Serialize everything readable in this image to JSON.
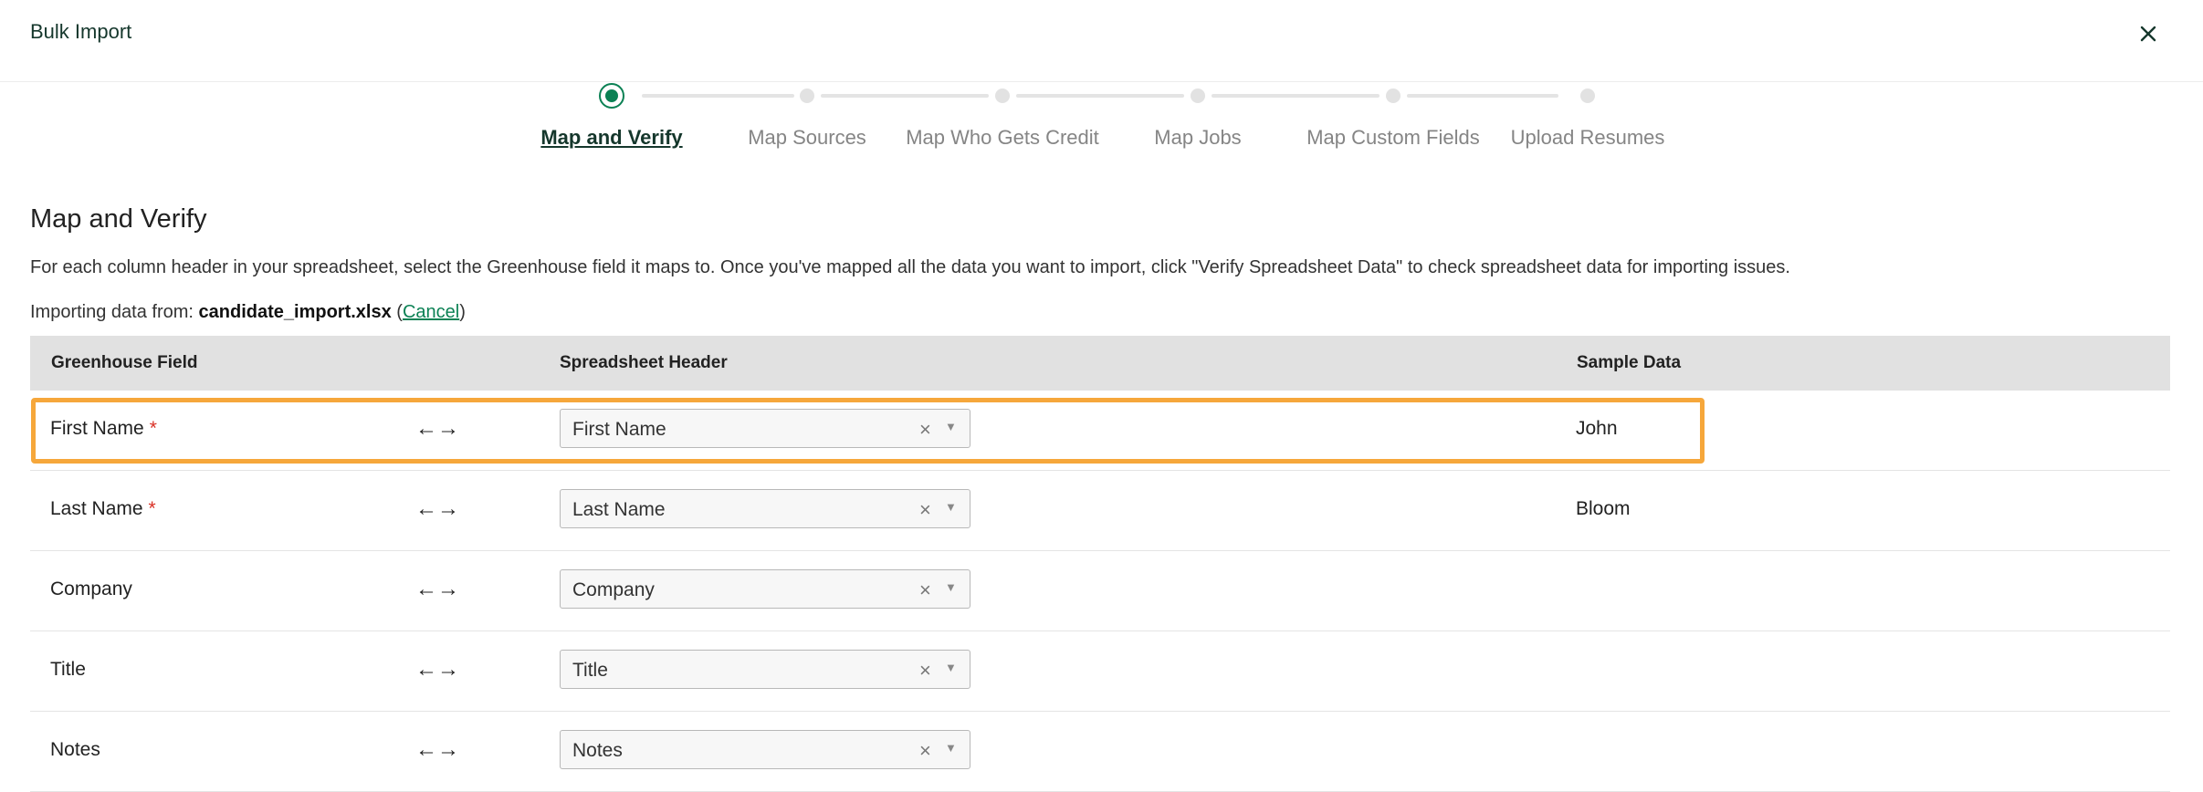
{
  "header": {
    "title": "Bulk Import"
  },
  "steps": [
    {
      "label": "Map and Verify"
    },
    {
      "label": "Map Sources"
    },
    {
      "label": "Map Who Gets Credit"
    },
    {
      "label": "Map Jobs"
    },
    {
      "label": "Map Custom Fields"
    },
    {
      "label": "Upload Resumes"
    }
  ],
  "active_step": 0,
  "section": {
    "title": "Map and Verify",
    "description": "For each column header in your spreadsheet, select the Greenhouse field it maps to. Once you've mapped all the data you want to import, click \"Verify Spreadsheet Data\" to check spreadsheet data for importing issues.",
    "import_prefix": "Importing data from:",
    "filename": "candidate_import.xlsx",
    "cancel_label": "Cancel"
  },
  "table": {
    "headers": {
      "field": "Greenhouse Field",
      "spreadsheet": "Spreadsheet Header",
      "sample": "Sample Data"
    },
    "arrow_glyph": "←→",
    "clear_glyph": "×",
    "dropdown_glyph": "▼",
    "required_mark": "*",
    "rows": [
      {
        "field": "First Name",
        "required": true,
        "header": "First Name",
        "sample": "John"
      },
      {
        "field": "Last Name",
        "required": true,
        "header": "Last Name",
        "sample": "Bloom"
      },
      {
        "field": "Company",
        "required": false,
        "header": "Company",
        "sample": ""
      },
      {
        "field": "Title",
        "required": false,
        "header": "Title",
        "sample": ""
      },
      {
        "field": "Notes",
        "required": false,
        "header": "Notes",
        "sample": ""
      }
    ]
  },
  "colors": {
    "accent": "#0b8154",
    "highlight": "#f6a73b",
    "required": "#d93025"
  }
}
